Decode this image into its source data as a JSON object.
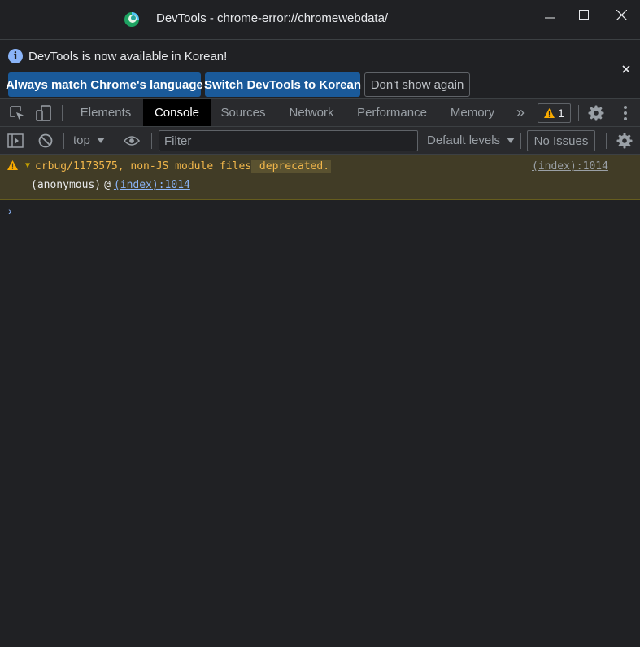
{
  "window": {
    "title": "DevTools - chrome-error://chromewebdata/"
  },
  "infobar": {
    "message": "DevTools is now available in Korean!",
    "buttons": {
      "match_language": "Always match Chrome's language",
      "switch_korean": "Switch DevTools to Korean",
      "dont_show": "Don't show again"
    }
  },
  "tabs": {
    "elements": "Elements",
    "console": "Console",
    "sources": "Sources",
    "network": "Network",
    "performance": "Performance",
    "memory": "Memory",
    "more": "»",
    "warning_count": "1"
  },
  "console_toolbar": {
    "context": "top",
    "filter_placeholder": "Filter",
    "levels": "Default levels",
    "issues": "No Issues"
  },
  "messages": [
    {
      "level": "warning",
      "text_prefix": "crbug/1173575, non-JS module files",
      "text_highlight": " deprecated.",
      "source": "(index):1014",
      "stack_fn": "(anonymous)",
      "stack_at": "@",
      "stack_src": "(index):1014"
    }
  ],
  "prompt": "›",
  "colors": {
    "accent_blue": "#8ab4f8",
    "warning_bg": "#413c26",
    "warning_text": "#f2b74b",
    "primary_button": "#1a5a9a"
  }
}
